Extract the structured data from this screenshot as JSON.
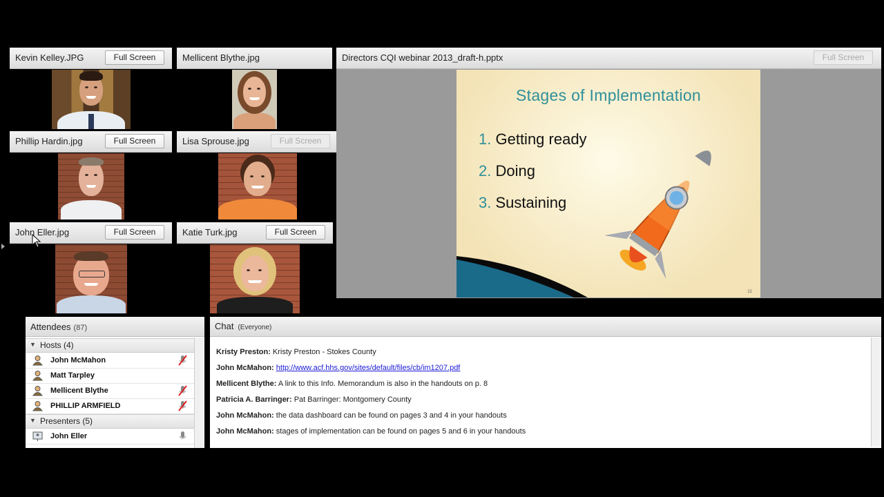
{
  "video_pods": [
    {
      "title": "Kevin Kelley.JPG",
      "button": "Full Screen",
      "button_enabled": true
    },
    {
      "title": "Mellicent Blythe.jpg",
      "button": "",
      "button_enabled": false
    },
    {
      "title": "Phillip Hardin.jpg",
      "button": "Full Screen",
      "button_enabled": true
    },
    {
      "title": "Lisa Sprouse.jpg",
      "button": "Full Screen",
      "button_enabled": false
    },
    {
      "title": "John Eller.jpg",
      "button": "Full Screen",
      "button_enabled": true
    },
    {
      "title": "Katie Turk.jpg",
      "button": "Full Screen",
      "button_enabled": true
    }
  ],
  "share_pod": {
    "title": "Directors CQI webinar 2013_draft-h.pptx",
    "button": "Full Screen",
    "slide": {
      "title": "Stages of Implementation",
      "items": [
        {
          "num": "1.",
          "text": "Getting ready"
        },
        {
          "num": "2.",
          "text": "Doing"
        },
        {
          "num": "3.",
          "text": "Sustaining"
        }
      ],
      "page": "22"
    }
  },
  "attendees": {
    "title": "Attendees",
    "count": "(87)",
    "groups": [
      {
        "label": "Hosts (4)",
        "members": [
          "John McMahon",
          "Matt Tarpley",
          "Mellicent Blythe",
          "PHILLIP ARMFIELD"
        ]
      },
      {
        "label": "Presenters (5)",
        "members": [
          "John Eller"
        ]
      }
    ]
  },
  "chat": {
    "title": "Chat",
    "subtitle": "(Everyone)",
    "messages": [
      {
        "who": "Kristy Preston:",
        "text": "Kristy Preston - Stokes County",
        "link": ""
      },
      {
        "who": "John McMahon:",
        "text": "",
        "link": "http://www.acf.hhs.gov/sites/default/files/cb/im1207.pdf"
      },
      {
        "who": "Mellicent Blythe:",
        "text": "A link to this Info. Memorandum is also in the handouts on p. 8",
        "link": ""
      },
      {
        "who": "Patricia A. Barringer:",
        "text": "Pat Barringer: Montgomery County",
        "link": ""
      },
      {
        "who": "John McMahon:",
        "text": "the data dashboard can be found on pages 3 and 4 in your handouts",
        "link": ""
      },
      {
        "who": "John McMahon:",
        "text": "stages of implementation can be found on pages 5 and 6 in your handouts",
        "link": ""
      }
    ]
  },
  "colors": {
    "accent": "#2e8f9a",
    "link": "#1a1ad6"
  }
}
